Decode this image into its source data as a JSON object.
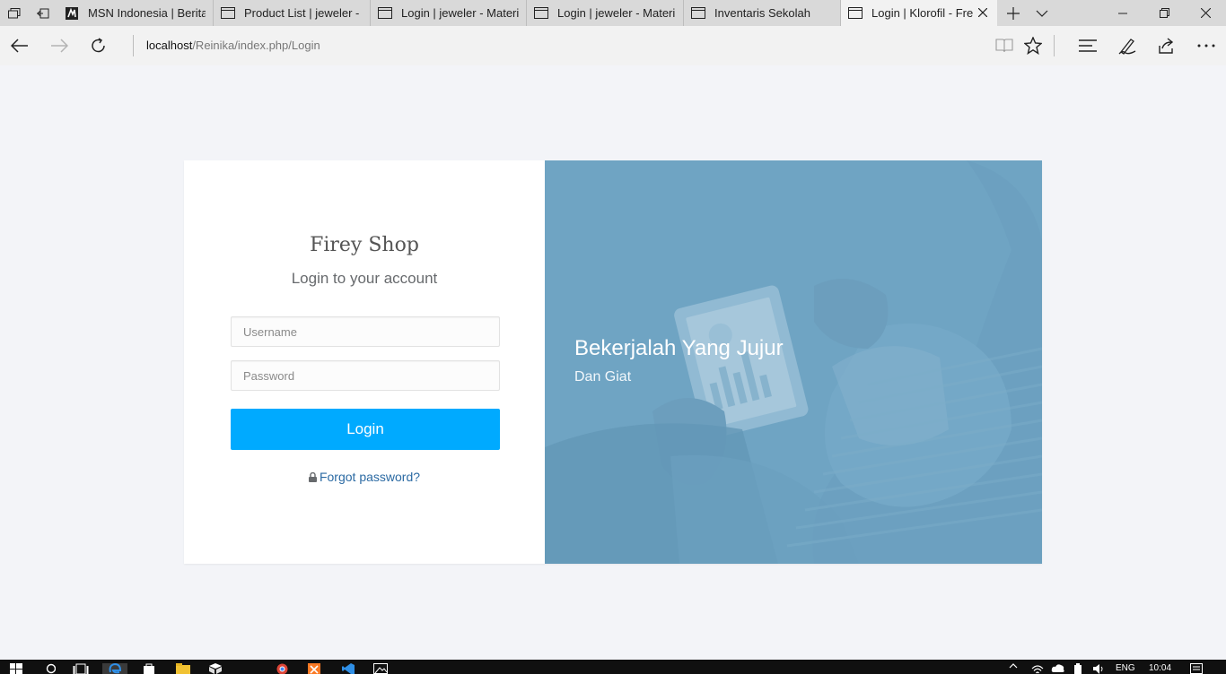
{
  "browser": {
    "tabs": [
      {
        "label": "MSN Indonesia | Berita",
        "icon": "msn-icon"
      },
      {
        "label": "Product List | jeweler - I",
        "icon": "page-icon"
      },
      {
        "label": "Login | jeweler - Materi",
        "icon": "page-icon"
      },
      {
        "label": "Login | jeweler - Materi",
        "icon": "page-icon"
      },
      {
        "label": "Inventaris Sekolah",
        "icon": "page-icon"
      },
      {
        "label": "Login | Klorofil - Fre",
        "icon": "page-icon",
        "active": true
      }
    ],
    "url_host": "localhost",
    "url_path": "/Reinika/index.php/Login"
  },
  "login": {
    "brand": "Firey Shop",
    "subtitle": "Login to your account",
    "username_placeholder": "Username",
    "password_placeholder": "Password",
    "button_label": "Login",
    "forgot_label": "Forgot password?"
  },
  "hero": {
    "title": "Bekerjalah Yang Jujur",
    "subtitle": "Dan Giat"
  },
  "taskbar": {
    "lang": "ENG",
    "time": "10:04"
  },
  "colors": {
    "accent": "#00aaff",
    "link": "#2b6aa3",
    "hero_overlay": "#6fa4c3",
    "page_bg": "#f3f4f8"
  }
}
